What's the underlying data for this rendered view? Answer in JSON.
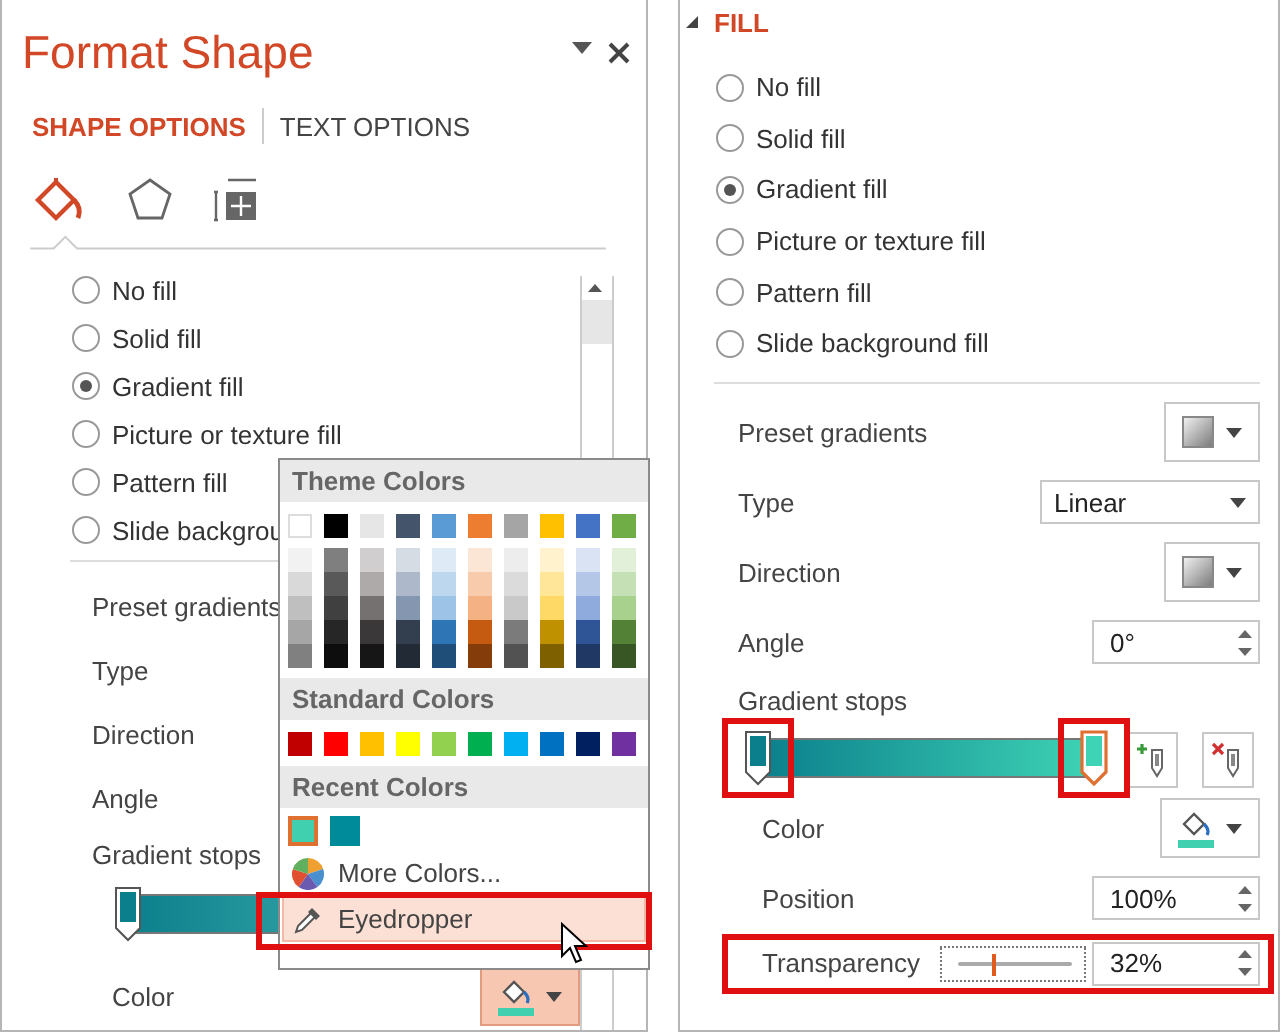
{
  "left_pane": {
    "title": "Format Shape",
    "tabs": [
      {
        "label": "SHAPE OPTIONS",
        "selected": true
      },
      {
        "label": "TEXT OPTIONS",
        "selected": false
      }
    ],
    "icon_tabs": [
      {
        "kind": "fill",
        "selected": true
      },
      {
        "kind": "effects",
        "selected": false
      },
      {
        "kind": "size",
        "selected": false
      }
    ],
    "fill_options": [
      {
        "label": "No fill",
        "selected": false
      },
      {
        "label": "Solid fill",
        "selected": false
      },
      {
        "label": "Gradient fill",
        "selected": true
      },
      {
        "label": "Picture or texture fill",
        "selected": false
      },
      {
        "label": "Pattern fill",
        "selected": false
      },
      {
        "label": "Slide backgrou",
        "selected": false
      }
    ],
    "properties": [
      "Preset gradients",
      "Type",
      "Direction",
      "Angle"
    ],
    "stops_label": "Gradient stops",
    "stops": [
      {
        "color": "#0b7f8c",
        "level": 0,
        "selected": false
      }
    ],
    "color_label": "Color",
    "color_button": {
      "color": "#40d0b0",
      "highlighted": true
    },
    "color_menu": {
      "theme_header": "Theme Colors",
      "theme_colors": [
        {
          "color": "#ffffff",
          "shades": [
            {
              "color": "#f2f2f2"
            },
            {
              "color": "#d9d9d9"
            },
            {
              "color": "#bfbfbf"
            },
            {
              "color": "#a6a6a6"
            },
            {
              "color": "#808080"
            }
          ]
        },
        {
          "color": "#000000",
          "shades": [
            {
              "color": "#7f7f7f"
            },
            {
              "color": "#595959"
            },
            {
              "color": "#404040"
            },
            {
              "color": "#262626"
            },
            {
              "color": "#0d0d0d"
            }
          ]
        },
        {
          "color": "#e7e6e6",
          "shades": [
            {
              "color": "#d0cece"
            },
            {
              "color": "#aeaaaa"
            },
            {
              "color": "#757171"
            },
            {
              "color": "#3a3838"
            },
            {
              "color": "#171616"
            }
          ]
        },
        {
          "color": "#44546a",
          "shades": [
            {
              "color": "#d6dce4"
            },
            {
              "color": "#adb9ca"
            },
            {
              "color": "#8496b0"
            },
            {
              "color": "#333f4f"
            },
            {
              "color": "#222a35"
            }
          ]
        },
        {
          "color": "#5b9bd5",
          "shades": [
            {
              "color": "#deebf6"
            },
            {
              "color": "#bdd7ee"
            },
            {
              "color": "#9dc3e6"
            },
            {
              "color": "#2e75b5"
            },
            {
              "color": "#1f4e79"
            }
          ]
        },
        {
          "color": "#ed7d31",
          "shades": [
            {
              "color": "#fbe5d5"
            },
            {
              "color": "#f7cbac"
            },
            {
              "color": "#f4b183"
            },
            {
              "color": "#c55a11"
            },
            {
              "color": "#843c0b"
            }
          ]
        },
        {
          "color": "#a5a5a5",
          "shades": [
            {
              "color": "#ededed"
            },
            {
              "color": "#dbdbdb"
            },
            {
              "color": "#c9c9c9"
            },
            {
              "color": "#7b7b7b"
            },
            {
              "color": "#525252"
            }
          ]
        },
        {
          "color": "#ffc000",
          "shades": [
            {
              "color": "#fff2cc"
            },
            {
              "color": "#ffe699"
            },
            {
              "color": "#ffd966"
            },
            {
              "color": "#bf9000"
            },
            {
              "color": "#7f6000"
            }
          ]
        },
        {
          "color": "#4472c4",
          "shades": [
            {
              "color": "#dae3f3"
            },
            {
              "color": "#b4c7e7"
            },
            {
              "color": "#8faadc"
            },
            {
              "color": "#2f5597"
            },
            {
              "color": "#1f3864"
            }
          ]
        },
        {
          "color": "#70ad47",
          "shades": [
            {
              "color": "#e2f0d9"
            },
            {
              "color": "#c5e0b4"
            },
            {
              "color": "#a9d18e"
            },
            {
              "color": "#538135"
            },
            {
              "color": "#375623"
            }
          ]
        }
      ],
      "standard_header": "Standard Colors",
      "standard_colors": [
        {
          "color": "#c00000"
        },
        {
          "color": "#ff0000"
        },
        {
          "color": "#ffc000"
        },
        {
          "color": "#ffff00"
        },
        {
          "color": "#92d050"
        },
        {
          "color": "#00b050"
        },
        {
          "color": "#00b0f0"
        },
        {
          "color": "#0070c0"
        },
        {
          "color": "#002060"
        },
        {
          "color": "#7030a0"
        }
      ],
      "recent_header": "Recent Colors",
      "recent_colors": [
        {
          "color": "#40d0b0",
          "selected": true
        },
        {
          "color": "#008b9a",
          "selected": false
        }
      ],
      "items": [
        {
          "kind": "more",
          "label": "More Colors...",
          "selected": false,
          "annotated": false
        },
        {
          "kind": "eyedropper",
          "label": "Eyedropper",
          "selected": true,
          "annotated": true
        }
      ]
    }
  },
  "right_pane": {
    "section": "FILL",
    "expanded": true,
    "fill_options": [
      {
        "label": "No fill",
        "selected": false
      },
      {
        "label": "Solid fill",
        "selected": false
      },
      {
        "label": "Gradient fill",
        "selected": true
      },
      {
        "label": "Picture or texture fill",
        "selected": false
      },
      {
        "label": "Pattern fill",
        "selected": false
      },
      {
        "label": "Slide background fill",
        "selected": false
      }
    ],
    "preset_label": "Preset gradients",
    "type_label": "Type",
    "type_value": "Linear",
    "direction_label": "Direction",
    "angle_label": "Angle",
    "angle_value": "0°",
    "stops_label": "Gradient stops",
    "stops": [
      {
        "color": "#0b7f8c",
        "level": 0,
        "selected": false,
        "annotated": true
      },
      {
        "color": "#3ed3b5",
        "level": 1,
        "selected": true,
        "annotated": true
      }
    ],
    "color_label": "Color",
    "color": "#40d0b0",
    "position_label": "Position",
    "position_value": "100%",
    "transparency_label": "Transparency",
    "transparency": {
      "level": 0.32,
      "value": "32%",
      "annotated": true
    }
  }
}
